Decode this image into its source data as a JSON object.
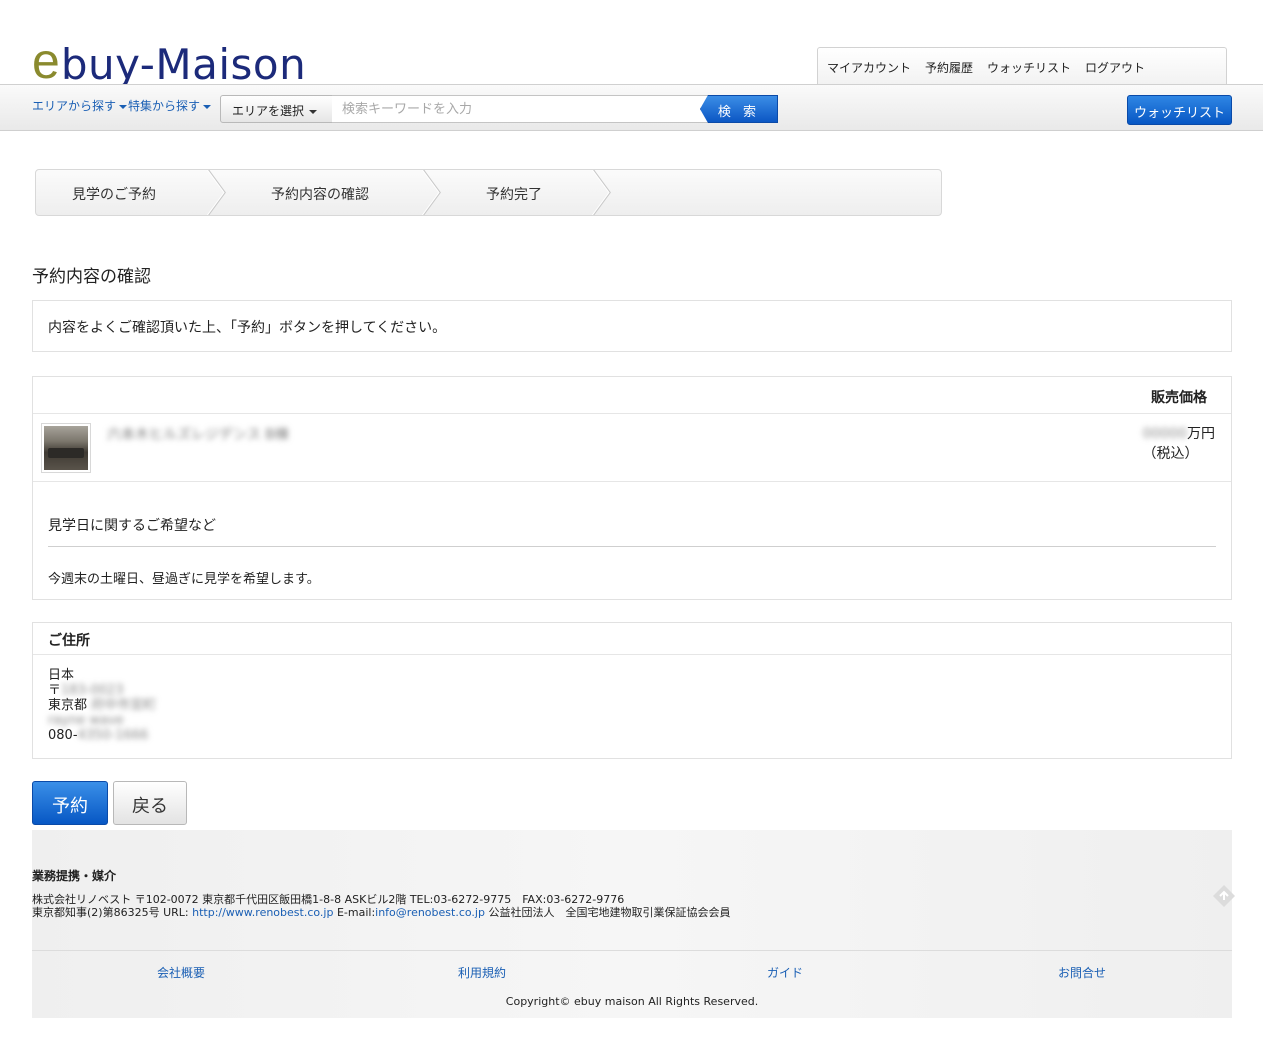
{
  "logo": {
    "e": "e",
    "rest": "buy-Maison"
  },
  "account_nav": {
    "items": [
      "マイアカウント",
      "予約履歴",
      "ウォッチリスト",
      "ログアウト"
    ]
  },
  "searchbar": {
    "area_link": "エリアから探す",
    "feature_link": "特集から探す",
    "area_select": "エリアを選択",
    "placeholder": "検索キーワードを入力",
    "search_button": "検 索",
    "watchlist_button": "ウォッチリスト"
  },
  "steps": [
    "見学のご予約",
    "予約内容の確認",
    "予約完了"
  ],
  "page_title": "予約内容の確認",
  "notice": "内容をよくご確認頂いた上、「予約」ボタンを押してください。",
  "property": {
    "price_header": "販売価格",
    "name": "六本木ヒルズレジデンス B棟",
    "price_value": "00000",
    "price_unit": "万円",
    "tax_note": "（税込）",
    "wish_label": "見学日に関するご希望など",
    "wish_text": "今週末の土曜日、昼過ぎに見学を希望します。"
  },
  "address": {
    "header": "ご住所",
    "country": "日本",
    "postal_prefix": "〒",
    "postal_blur": "183-0023",
    "pref": "東京都",
    "city_blur": "府中市宮町",
    "street_blur": "rayne wave",
    "phone_prefix": "080-",
    "phone_blur": "4350-1666"
  },
  "buttons": {
    "reserve": "予約",
    "back": "戻る"
  },
  "footer": {
    "title": "業務提携・媒介",
    "line1": "株式会社リノベスト 〒102-0072 東京都千代田区飯田橋1-8-8 ASKビル2階 TEL:03-6272-9775　FAX:03-6272-9776",
    "line2_a": "東京都知事(2)第86325号 URL: ",
    "line2_url": "http://www.renobest.co.jp",
    "line2_b": " E-mail:",
    "line2_mail": "info@renobest.co.jp",
    "line2_c": " 公益社団法人　全国宅地建物取引業保証協会会員",
    "links": [
      "会社概要",
      "利用規約",
      "ガイド",
      "お問合せ"
    ],
    "copyright": "Copyright© ebuy maison All Rights Reserved."
  },
  "colors": {
    "brand_blue": "#1c2a7a",
    "brand_olive": "#8a8a2e",
    "button_blue": "#0c57c4",
    "link_blue": "#1a5fb4"
  }
}
